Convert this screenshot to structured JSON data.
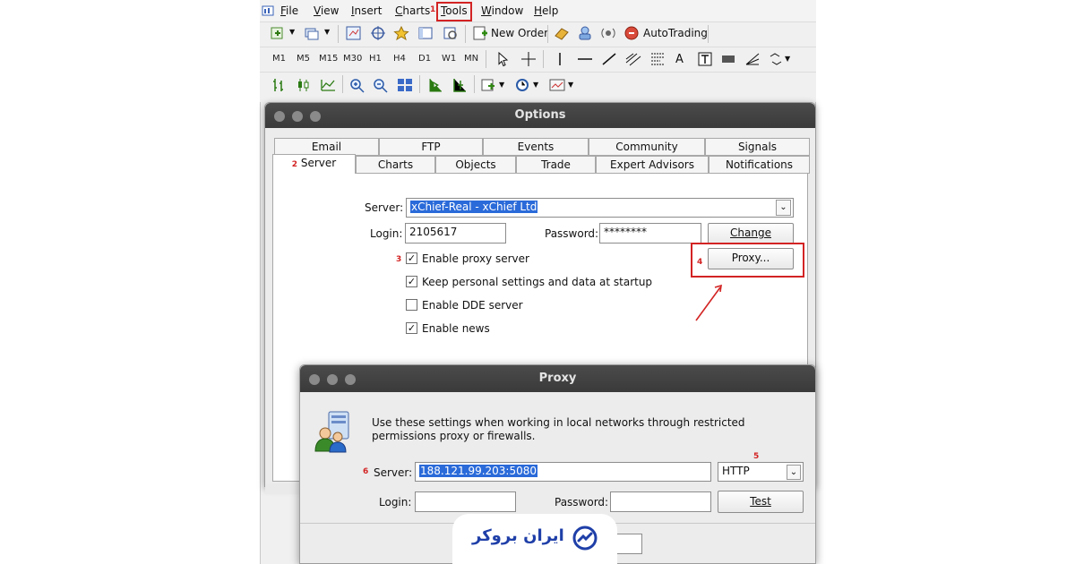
{
  "menubar": {
    "items": [
      {
        "label": "File",
        "u": "F",
        "rest": "ile"
      },
      {
        "label": "View",
        "u": "V",
        "rest": "iew"
      },
      {
        "label": "Insert",
        "u": "I",
        "rest": "nsert"
      },
      {
        "label": "Charts",
        "u": "C",
        "rest": "harts"
      },
      {
        "label": "Tools",
        "u": "T",
        "rest": "ools"
      },
      {
        "label": "Window",
        "u": "W",
        "rest": "indow"
      },
      {
        "label": "Help",
        "u": "H",
        "rest": "elp"
      }
    ],
    "step1": "1"
  },
  "toolbar": {
    "new_order": "New Order",
    "autotrading": "AutoTrading",
    "timeframes": [
      "M1",
      "M5",
      "M15",
      "M30",
      "H1",
      "H4",
      "D1",
      "W1",
      "MN"
    ],
    "text_tool": "A"
  },
  "options": {
    "title": "Options",
    "tabs_top": [
      "Email",
      "FTP",
      "Events",
      "Community",
      "Signals"
    ],
    "tabs_bottom": [
      "Server",
      "Charts",
      "Objects",
      "Trade",
      "Expert Advisors",
      "Notifications"
    ],
    "step2": "2",
    "server_label": "Server:",
    "server_value": "xChief-Real - xChief Ltd",
    "login_label": "Login:",
    "login_value": "2105617",
    "password_label": "Password:",
    "password_value": "********",
    "change_button": "Change",
    "proxy_button": "Proxy...",
    "step3": "3",
    "step4": "4",
    "checkboxes": [
      {
        "label": "Enable proxy server",
        "checked": true
      },
      {
        "label": "Keep personal settings and data at startup",
        "checked": true
      },
      {
        "label": "Enable DDE server",
        "checked": false
      },
      {
        "label": "Enable news",
        "checked": true
      }
    ]
  },
  "proxy": {
    "title": "Proxy",
    "description": "Use these settings when working in local networks through restricted permissions proxy or firewalls.",
    "step5": "5",
    "step6": "6",
    "server_label": "Server:",
    "server_value": "188.121.99.203:5080",
    "type_value": "HTTP",
    "login_label": "Login:",
    "login_value": "",
    "password_label": "Password:",
    "password_value": "",
    "test_button": "Test"
  },
  "brand": {
    "logo_text": "ایران بروکر",
    "accent": "#1f3fa8"
  }
}
